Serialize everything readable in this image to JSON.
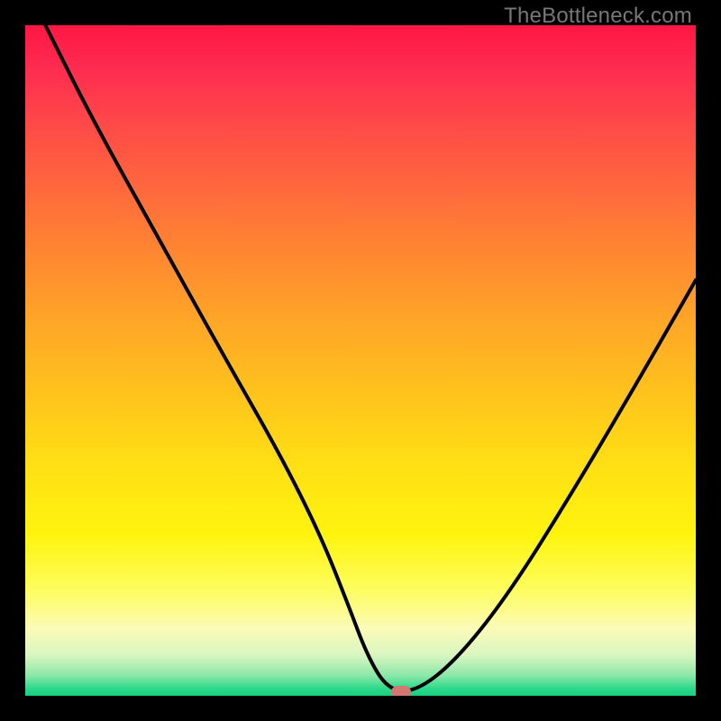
{
  "watermark": "TheBottleneck.com",
  "chart_data": {
    "type": "line",
    "title": "",
    "xlabel": "",
    "ylabel": "",
    "xlim": [
      0,
      100
    ],
    "ylim": [
      0,
      100
    ],
    "series": [
      {
        "name": "curve",
        "x": [
          3,
          10,
          20,
          30,
          38,
          44,
          48,
          51,
          54,
          58,
          64,
          72,
          82,
          92,
          100
        ],
        "y": [
          100,
          86,
          68,
          50,
          36,
          24,
          14,
          6,
          1,
          0.5,
          5,
          15,
          31,
          48,
          62
        ]
      }
    ],
    "marker": {
      "x": 56,
      "y": 0.5
    },
    "gradient_stops": [
      {
        "pos": 0,
        "color": "#ff1744"
      },
      {
        "pos": 50,
        "color": "#ffc31c"
      },
      {
        "pos": 80,
        "color": "#fff40e"
      },
      {
        "pos": 100,
        "color": "#18d080"
      }
    ]
  }
}
